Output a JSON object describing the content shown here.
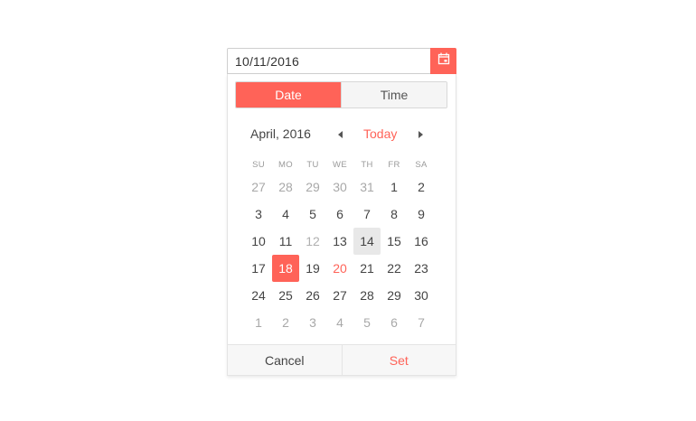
{
  "input": {
    "value": "10/11/2016"
  },
  "tabs": [
    {
      "label": "Date",
      "active": true
    },
    {
      "label": "Time",
      "active": false
    }
  ],
  "calendar": {
    "title": "April, 2016",
    "today_label": "Today",
    "weekdays": [
      "SU",
      "MO",
      "TU",
      "WE",
      "TH",
      "FR",
      "SA"
    ],
    "weeks": [
      [
        {
          "d": "27",
          "s": "other"
        },
        {
          "d": "28",
          "s": "other"
        },
        {
          "d": "29",
          "s": "other"
        },
        {
          "d": "30",
          "s": "other"
        },
        {
          "d": "31",
          "s": "other"
        },
        {
          "d": "1",
          "s": ""
        },
        {
          "d": "2",
          "s": ""
        }
      ],
      [
        {
          "d": "3",
          "s": ""
        },
        {
          "d": "4",
          "s": ""
        },
        {
          "d": "5",
          "s": ""
        },
        {
          "d": "6",
          "s": ""
        },
        {
          "d": "7",
          "s": ""
        },
        {
          "d": "8",
          "s": ""
        },
        {
          "d": "9",
          "s": ""
        }
      ],
      [
        {
          "d": "10",
          "s": ""
        },
        {
          "d": "11",
          "s": ""
        },
        {
          "d": "12",
          "s": "disabled"
        },
        {
          "d": "13",
          "s": ""
        },
        {
          "d": "14",
          "s": "focused"
        },
        {
          "d": "15",
          "s": ""
        },
        {
          "d": "16",
          "s": ""
        }
      ],
      [
        {
          "d": "17",
          "s": ""
        },
        {
          "d": "18",
          "s": "selected"
        },
        {
          "d": "19",
          "s": ""
        },
        {
          "d": "20",
          "s": "today"
        },
        {
          "d": "21",
          "s": ""
        },
        {
          "d": "22",
          "s": ""
        },
        {
          "d": "23",
          "s": ""
        }
      ],
      [
        {
          "d": "24",
          "s": ""
        },
        {
          "d": "25",
          "s": ""
        },
        {
          "d": "26",
          "s": ""
        },
        {
          "d": "27",
          "s": ""
        },
        {
          "d": "28",
          "s": ""
        },
        {
          "d": "29",
          "s": ""
        },
        {
          "d": "30",
          "s": ""
        }
      ],
      [
        {
          "d": "1",
          "s": "other"
        },
        {
          "d": "2",
          "s": "other"
        },
        {
          "d": "3",
          "s": "other"
        },
        {
          "d": "4",
          "s": "other"
        },
        {
          "d": "5",
          "s": "other"
        },
        {
          "d": "6",
          "s": "other"
        },
        {
          "d": "7",
          "s": "other"
        }
      ]
    ]
  },
  "footer": {
    "cancel_label": "Cancel",
    "set_label": "Set"
  },
  "icons": {
    "calendar": "calendar-icon",
    "prev": "caret-left-icon",
    "next": "caret-right-icon"
  },
  "colors": {
    "accent": "#ff6358",
    "focused_bg": "#e8e8e8",
    "muted_text": "#a8a8a8"
  }
}
